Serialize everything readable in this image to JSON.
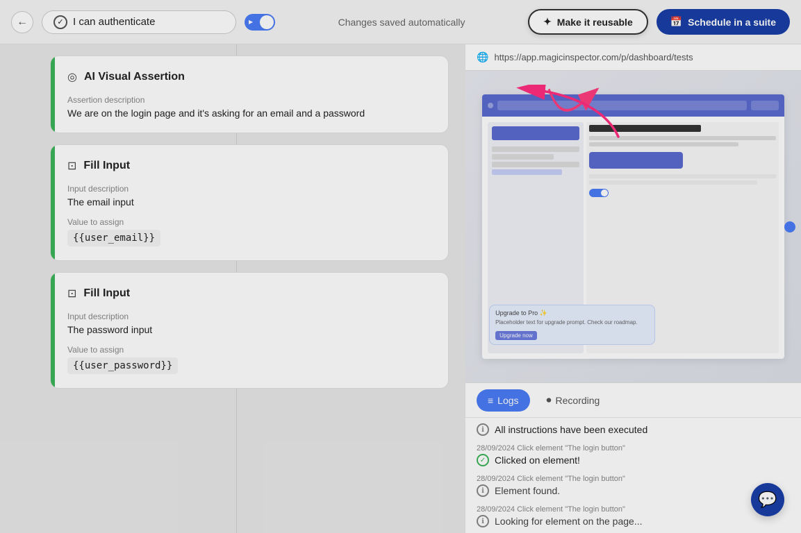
{
  "header": {
    "back_label": "←",
    "title": "I can authenticate",
    "check_icon": "✓",
    "play_icon": "▶",
    "auto_save": "Changes saved automatically",
    "reusable_icon": "✦",
    "reusable_label": "Make it reusable",
    "schedule_icon": "📅",
    "schedule_label": "Schedule in a suite"
  },
  "steps": [
    {
      "id": "step-1",
      "type": "AI Visual Assertion",
      "icon": "◎",
      "fields": [
        {
          "label": "Assertion description",
          "value": "We are on the login page and it's asking for an email and a password"
        }
      ]
    },
    {
      "id": "step-2",
      "type": "Fill Input",
      "icon": "⊡",
      "fields": [
        {
          "label": "Input description",
          "value": "The email input"
        },
        {
          "label": "Value to assign",
          "value": "{{user_email}}"
        }
      ]
    },
    {
      "id": "step-3",
      "type": "Fill Input",
      "icon": "⊡",
      "fields": [
        {
          "label": "Input description",
          "value": "The password input"
        },
        {
          "label": "Value to assign",
          "value": "{{user_password}}"
        }
      ]
    }
  ],
  "preview": {
    "url": "https://app.magicinspector.com/p/dashboard/tests"
  },
  "tabs": [
    {
      "id": "logs",
      "label": "Logs",
      "icon": "≡",
      "active": true
    },
    {
      "id": "recording",
      "label": "Recording",
      "icon": "⏺",
      "active": false
    }
  ],
  "logs": [
    {
      "meta": "",
      "badge_type": "success",
      "badge": "ℹ",
      "text": "All instructions have been executed"
    },
    {
      "meta": "28/09/2024  Click element \"The login button\"",
      "badge_type": "success",
      "badge": "✓",
      "text": "Clicked on element!"
    },
    {
      "meta": "28/09/2024  Click element \"The login button\"",
      "badge_type": "info",
      "badge": "ℹ",
      "text": "Element found."
    },
    {
      "meta": "28/09/2024  Click element \"The login button\"",
      "badge_type": "info",
      "badge": "ℹ",
      "text": "Looking for element on the page..."
    }
  ]
}
